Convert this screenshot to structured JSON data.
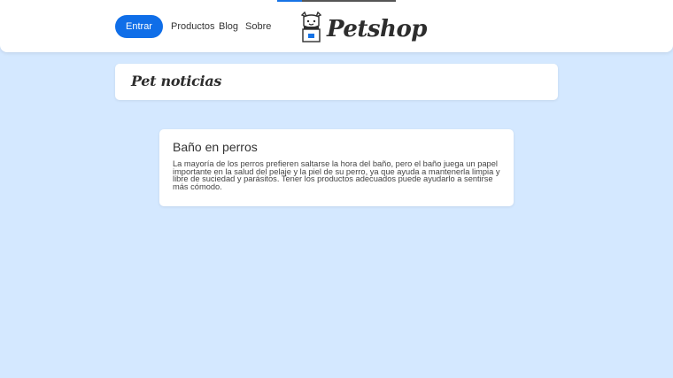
{
  "header": {
    "login_label": "Entrar",
    "nav": [
      "Productos",
      "Blog",
      "Sobre"
    ],
    "logo_text": "Petshop",
    "logo_icon": "dog-in-box-icon",
    "accent_color": "#0f6ee8"
  },
  "page": {
    "title": "Pet noticias"
  },
  "news": [
    {
      "title": "Baño en perros",
      "body": "La mayoría de los perros prefieren saltarse la hora del baño, pero el baño juega un papel importante en la salud del pelaje y la piel de su perro, ya que ayuda a mantenerla limpia y libre de suciedad y parásitos. Tener los productos adecuados puede ayudarlo a sentirse más cómodo."
    }
  ],
  "colors": {
    "background": "#d4e8ff",
    "card": "#ffffff"
  }
}
